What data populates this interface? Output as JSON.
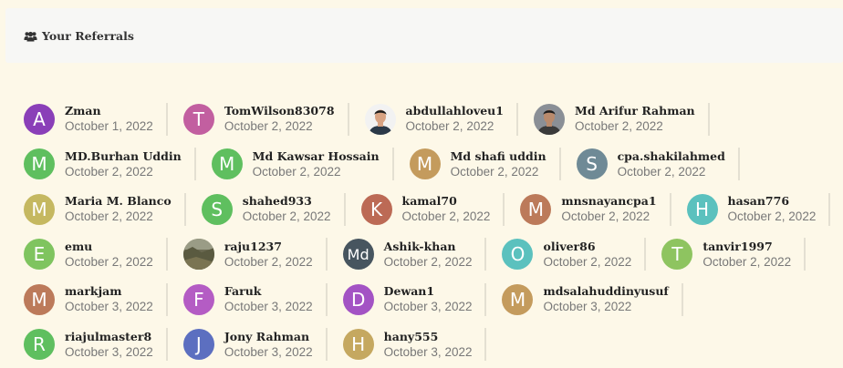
{
  "header": {
    "title": "Your Referrals",
    "icon": "users-icon"
  },
  "colors": {
    "purple": "#8a3fb8",
    "pink": "#c25fa0",
    "green": "#5fbf5f",
    "tan": "#c49b5d",
    "slate": "#6f8a96",
    "olive": "#c5b860",
    "rust": "#bc7050",
    "teal": "#5bc1be",
    "lime": "#8ec460",
    "darkslate": "#47555f",
    "violet": "#a353c4",
    "indigo": "#5c6fc0"
  },
  "rows": [
    [
      {
        "letter": "A",
        "color": "#8a3fb8",
        "name": "Zman",
        "date": "October 1, 2022"
      },
      {
        "letter": "T",
        "color": "#c25fa0",
        "name": "TomWilson83078",
        "date": "October 2, 2022"
      },
      {
        "photo": "person-photo-icon",
        "name": "abdullahloveu1",
        "date": "October 2, 2022"
      },
      {
        "photo": "person-photo-icon",
        "name": "Md Arifur Rahman",
        "date": "October 2, 2022"
      }
    ],
    [
      {
        "letter": "M",
        "color": "#5fbf5f",
        "name": "MD.Burhan Uddin",
        "date": "October 2, 2022"
      },
      {
        "letter": "M",
        "color": "#5fbf5f",
        "name": "Md Kawsar Hossain",
        "date": "October 2, 2022"
      },
      {
        "letter": "M",
        "color": "#c49b5d",
        "name": "Md shafi uddin",
        "date": "October 2, 2022"
      },
      {
        "letter": "S",
        "color": "#6f8a96",
        "name": "cpa.shakilahmed",
        "date": "October 2, 2022"
      }
    ],
    [
      {
        "letter": "M",
        "color": "#c5b860",
        "name": "Maria M. Blanco",
        "date": "October 2, 2022"
      },
      {
        "letter": "S",
        "color": "#5fbf5f",
        "name": "shahed933",
        "date": "October 2, 2022"
      },
      {
        "letter": "K",
        "color": "#bc6a55",
        "name": "kamal70",
        "date": "October 2, 2022"
      },
      {
        "letter": "M",
        "color": "#bc7a5a",
        "name": "mnsnayancpa1",
        "date": "October 2, 2022"
      },
      {
        "letter": "H",
        "color": "#5bc1be",
        "name": "hasan776",
        "date": "October 2, 2022"
      }
    ],
    [
      {
        "letter": "E",
        "color": "#7fc45f",
        "name": "emu",
        "date": "October 2, 2022"
      },
      {
        "photo": "landscape-photo-icon",
        "name": "raju1237",
        "date": "October 2, 2022"
      },
      {
        "letter": "Md",
        "color": "#47555f",
        "name": "Ashik-khan",
        "date": "October 2, 2022"
      },
      {
        "letter": "O",
        "color": "#5bc1be",
        "name": "oliver86",
        "date": "October 2, 2022"
      },
      {
        "letter": "T",
        "color": "#8ec460",
        "name": "tanvir1997",
        "date": "October 2, 2022"
      }
    ],
    [
      {
        "letter": "M",
        "color": "#bc7a5a",
        "name": "markjam",
        "date": "October 3, 2022"
      },
      {
        "letter": "F",
        "color": "#b45cc4",
        "name": "Faruk",
        "date": "October 3, 2022"
      },
      {
        "letter": "D",
        "color": "#a353c4",
        "name": "Dewan1",
        "date": "October 3, 2022"
      },
      {
        "letter": "M",
        "color": "#c49b5d",
        "name": "mdsalahuddinyusuf",
        "date": "October 3, 2022"
      }
    ],
    [
      {
        "letter": "R",
        "color": "#5fbf5f",
        "name": "riajulmaster8",
        "date": "October 3, 2022"
      },
      {
        "letter": "J",
        "color": "#5c6fc0",
        "name": "Jony Rahman",
        "date": "October 3, 2022"
      },
      {
        "letter": "H",
        "color": "#c5a860",
        "name": "hany555",
        "date": "October 3, 2022"
      }
    ]
  ]
}
